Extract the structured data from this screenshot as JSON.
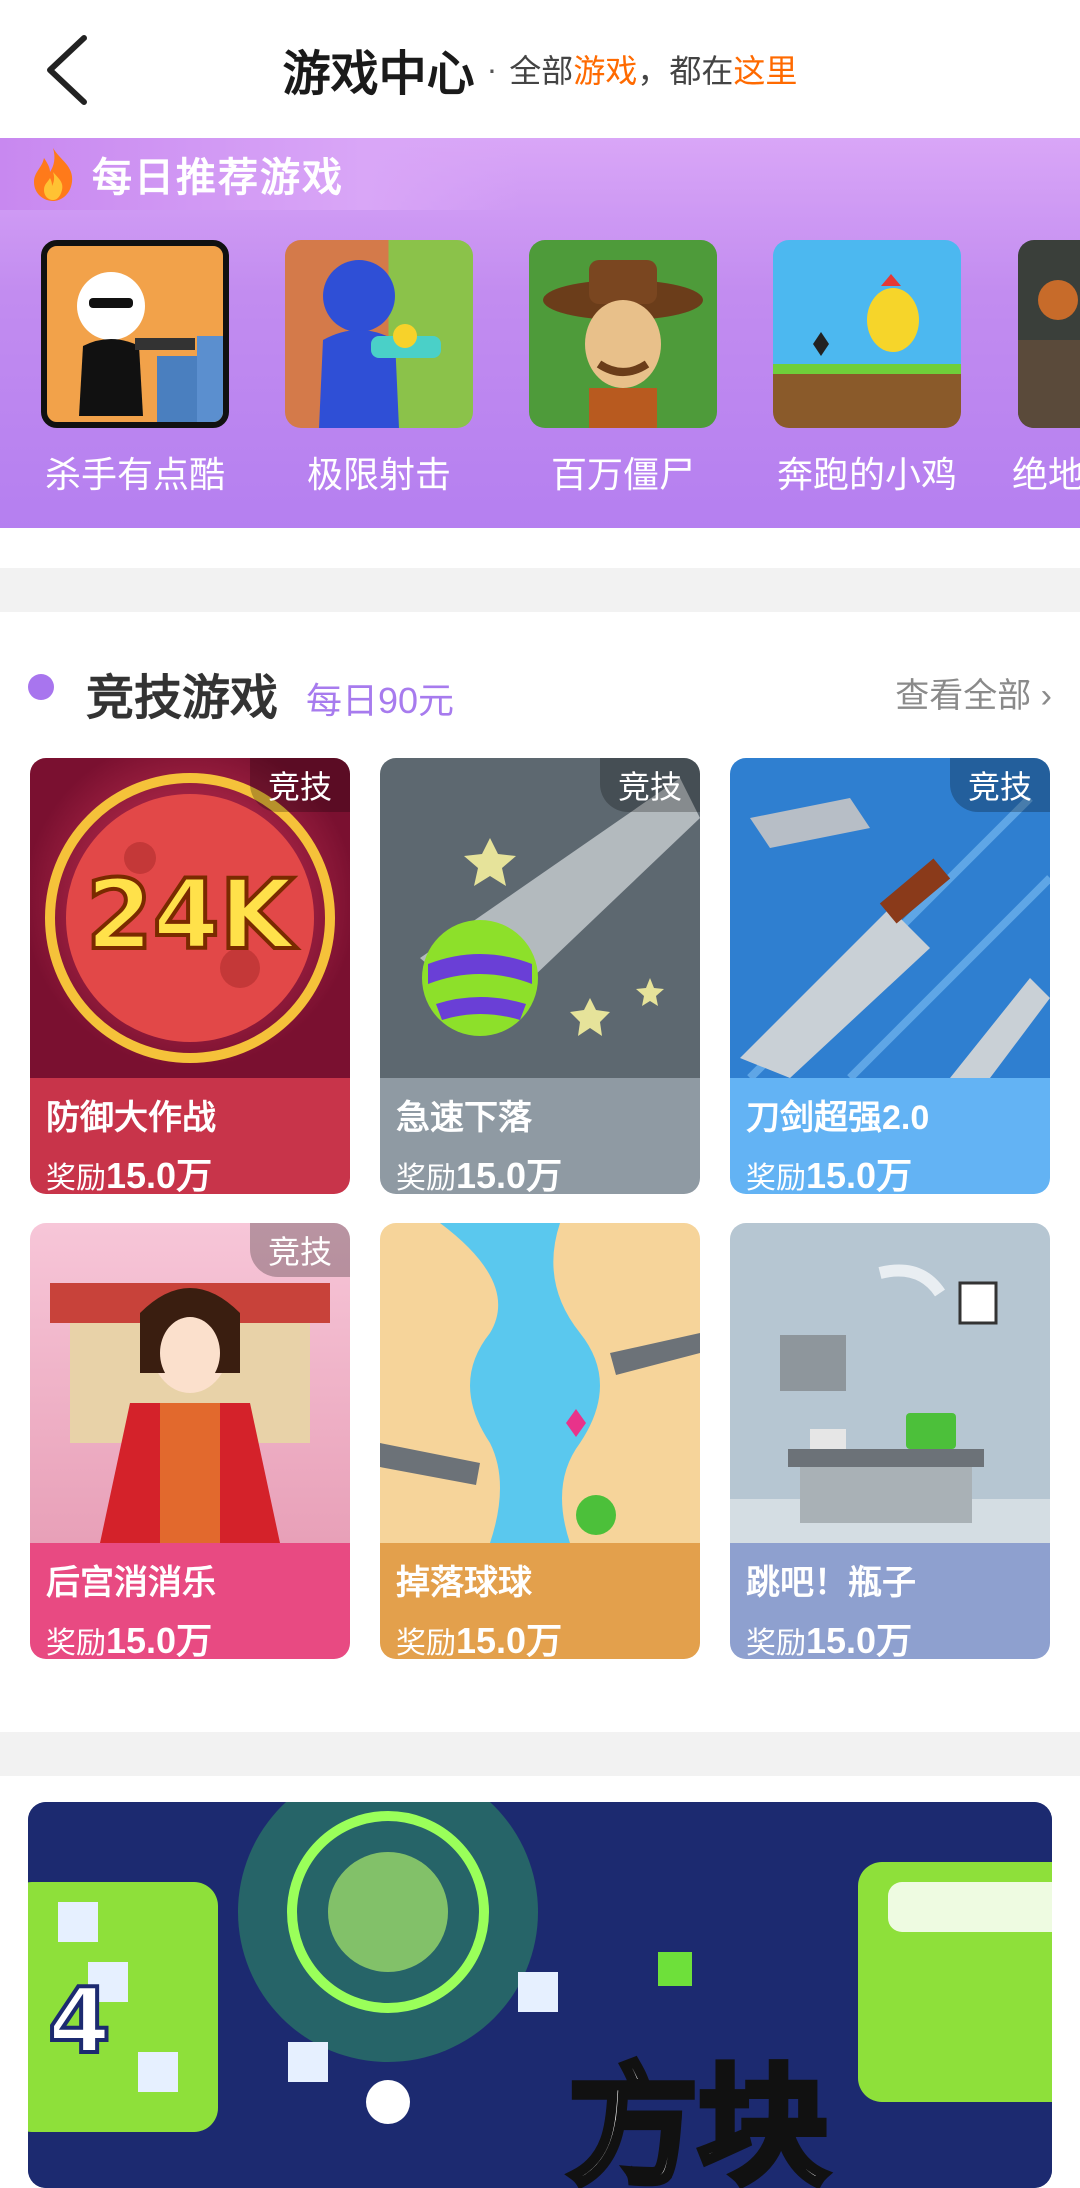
{
  "header": {
    "title": "游戏中心",
    "separator": "·",
    "subtitle_parts": [
      "全部",
      "游戏",
      "，都在",
      "这里"
    ]
  },
  "daily": {
    "title": "每日推荐游戏",
    "games": [
      {
        "name": "杀手有点酷"
      },
      {
        "name": "极限射击"
      },
      {
        "name": "百万僵尸"
      },
      {
        "name": "奔跑的小鸡"
      },
      {
        "name": "绝地"
      }
    ]
  },
  "section": {
    "title": "竞技游戏",
    "subtitle": "每日90元",
    "more_label": "查看全部",
    "more_chevron": "›"
  },
  "reward_label": "奖励",
  "cards": [
    {
      "name": "防御大作战",
      "reward": "15.0万",
      "badge": "竞技",
      "color": "#c8344a"
    },
    {
      "name": "急速下落",
      "reward": "15.0万",
      "badge": "竞技",
      "color": "#8f9aa3"
    },
    {
      "name": "刀剑超强2.0",
      "reward": "15.0万",
      "badge": "竞技",
      "color": "#63b3f4"
    },
    {
      "name": "后宫消消乐",
      "reward": "15.0万",
      "badge": "竞技",
      "color": "#e84a82"
    },
    {
      "name": "掉落球球",
      "reward": "15.0万",
      "badge": "",
      "color": "#e3a04c"
    },
    {
      "name": "跳吧！瓶子",
      "reward": "15.0万",
      "badge": "",
      "color": "#8ea0cf"
    }
  ],
  "promo": {
    "art_text": "方块",
    "number": "4"
  },
  "colors": {
    "accent_orange": "#ff6a00",
    "purple": "#a875ee",
    "daily_bg": "#c28cf0"
  }
}
